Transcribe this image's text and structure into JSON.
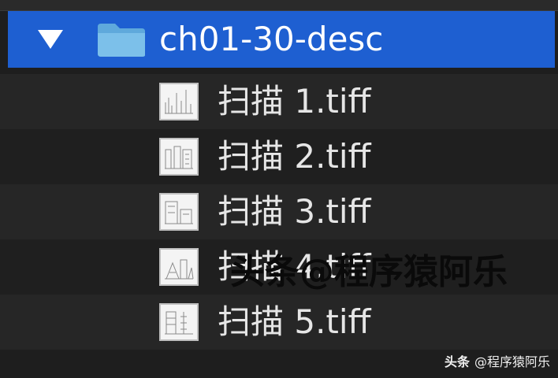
{
  "folder": {
    "name": "ch01-30-desc",
    "icon": "folder-icon",
    "expanded": true,
    "selection_color": "#1e5fd1"
  },
  "files": [
    {
      "name": "扫描 1.tiff",
      "icon": "tiff-thumbnail-icon"
    },
    {
      "name": "扫描 2.tiff",
      "icon": "tiff-thumbnail-icon"
    },
    {
      "name": "扫描 3.tiff",
      "icon": "tiff-thumbnail-icon"
    },
    {
      "name": "扫描 4.tiff",
      "icon": "tiff-thumbnail-icon"
    },
    {
      "name": "扫描 5.tiff",
      "icon": "tiff-thumbnail-icon"
    }
  ],
  "watermarks": {
    "overlay": "头条@程序猿阿乐",
    "footer_brand": "头条",
    "footer_handle": "@程序猿阿乐"
  }
}
